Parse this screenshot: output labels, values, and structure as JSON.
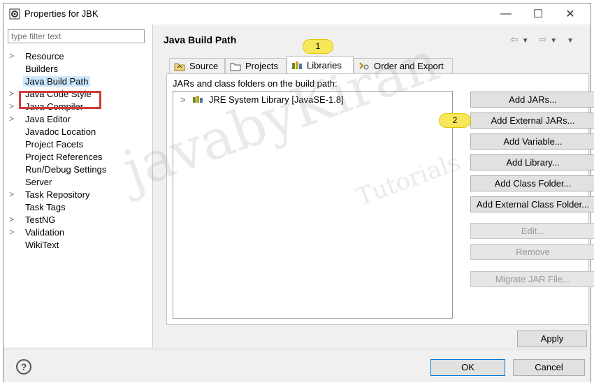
{
  "window": {
    "title": "Properties for JBK",
    "minimize": "—",
    "maximize": "☐",
    "close": "✕"
  },
  "sidebar": {
    "filter_placeholder": "type filter text",
    "items": [
      {
        "label": "Resource",
        "expandable": true
      },
      {
        "label": "Builders",
        "expandable": false
      },
      {
        "label": "Java Build Path",
        "expandable": false,
        "selected": true
      },
      {
        "label": "Java Code Style",
        "expandable": true
      },
      {
        "label": "Java Compiler",
        "expandable": true
      },
      {
        "label": "Java Editor",
        "expandable": true
      },
      {
        "label": "Javadoc Location",
        "expandable": false
      },
      {
        "label": "Project Facets",
        "expandable": false
      },
      {
        "label": "Project References",
        "expandable": false
      },
      {
        "label": "Run/Debug Settings",
        "expandable": false
      },
      {
        "label": "Server",
        "expandable": false
      },
      {
        "label": "Task Repository",
        "expandable": true
      },
      {
        "label": "Task Tags",
        "expandable": false
      },
      {
        "label": "TestNG",
        "expandable": true
      },
      {
        "label": "Validation",
        "expandable": true
      },
      {
        "label": "WikiText",
        "expandable": false
      }
    ]
  },
  "page": {
    "title": "Java Build Path",
    "tabs": [
      {
        "label": "Source",
        "icon": "source-folder-icon"
      },
      {
        "label": "Projects",
        "icon": "projects-folder-icon"
      },
      {
        "label": "Libraries",
        "icon": "libraries-icon",
        "active": true
      },
      {
        "label": "Order and Export",
        "icon": "order-export-icon"
      }
    ],
    "content_label": "JARs and class folders on the build path:",
    "libraries": [
      {
        "label": "JRE System Library [JavaSE-1.8]"
      }
    ],
    "buttons": {
      "add_jars": "Add JARs...",
      "add_external_jars": "Add External JARs...",
      "add_variable": "Add Variable...",
      "add_library": "Add Library...",
      "add_class_folder": "Add Class Folder...",
      "add_external_class_folder": "Add External Class Folder...",
      "edit": "Edit...",
      "remove": "Remove",
      "migrate": "Migrate JAR File..."
    },
    "apply": "Apply"
  },
  "callouts": {
    "one": "1",
    "two": "2"
  },
  "footer": {
    "ok": "OK",
    "cancel": "Cancel",
    "help": "?"
  },
  "watermark": {
    "main": "javabyKiran",
    "sub": "Tutorials"
  },
  "colors": {
    "selection_box": "#d23a3a",
    "callout": "#f7e75a",
    "selected_item": "#cde8ff"
  }
}
